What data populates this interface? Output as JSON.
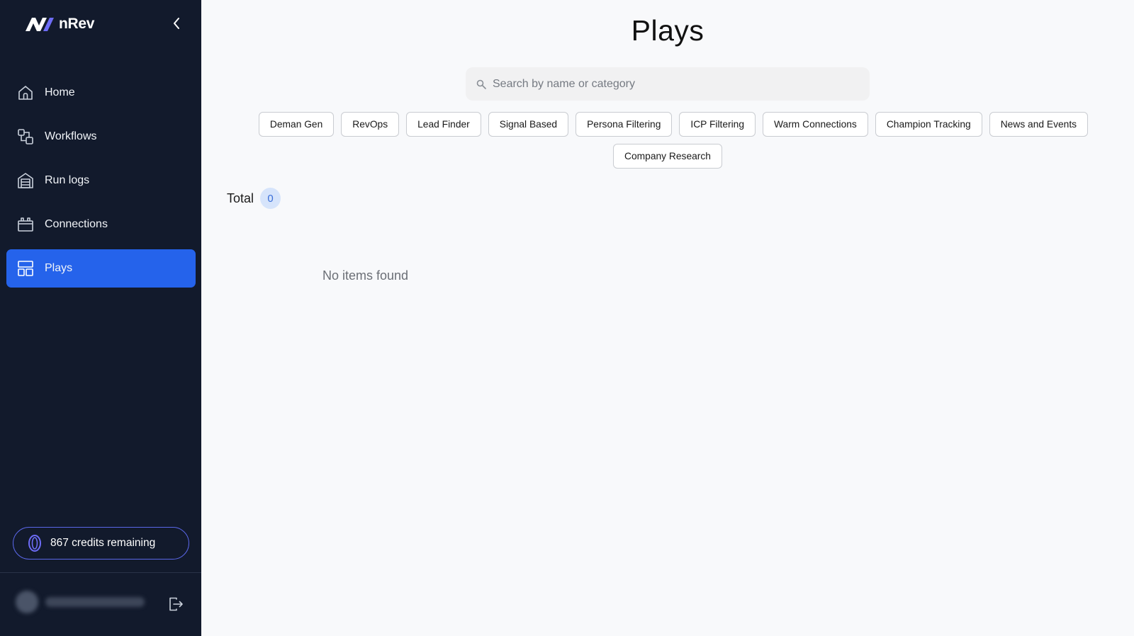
{
  "brand": {
    "name": "nRev",
    "accent": "#6d6cf7"
  },
  "sidebar": {
    "items": [
      {
        "label": "Home",
        "icon": "home-icon",
        "active": false
      },
      {
        "label": "Workflows",
        "icon": "workflow-icon",
        "active": false
      },
      {
        "label": "Run logs",
        "icon": "run-logs-icon",
        "active": false
      },
      {
        "label": "Connections",
        "icon": "connections-icon",
        "active": false
      },
      {
        "label": "Plays",
        "icon": "plays-icon",
        "active": true
      }
    ],
    "credits_label": "867 credits remaining",
    "active_color": "#2563eb",
    "background": "#121a2c"
  },
  "main": {
    "title": "Plays",
    "search": {
      "placeholder": "Search by name or category",
      "value": ""
    },
    "categories_row1": [
      "Deman Gen",
      "RevOps",
      "Lead Finder",
      "Signal Based",
      "Persona Filtering",
      "ICP Filtering",
      "Warm Connections",
      "Champion Tracking",
      "News and Events"
    ],
    "categories_row2": [
      "Company Research"
    ],
    "total_label": "Total",
    "total_count": "0",
    "empty_message": "No items found"
  }
}
